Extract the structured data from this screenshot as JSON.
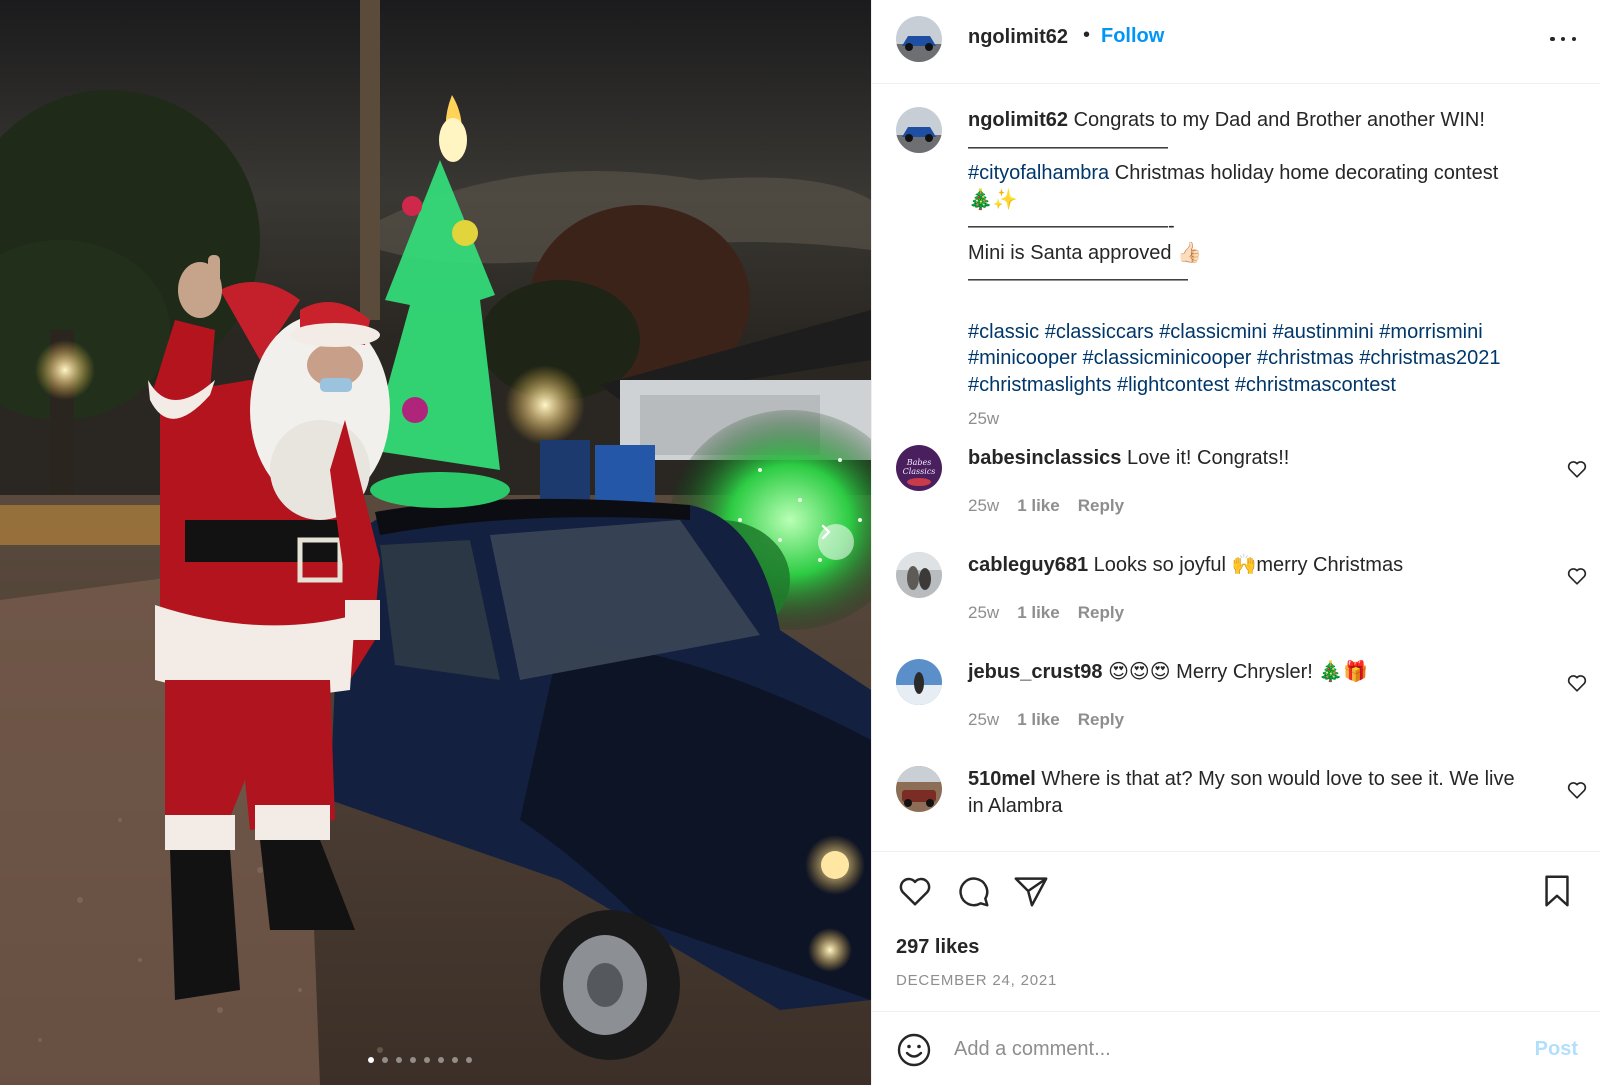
{
  "post": {
    "username": "ngolimit62",
    "separator": "•",
    "follow_label": "Follow",
    "more_options_icon": "ellipsis-icon"
  },
  "caption": {
    "username": "ngolimit62",
    "line1": "Congrats to my Dad and Brother another WIN!",
    "divider1": "——————————",
    "hashtag_city": "#cityofalhambra",
    "contest_text": "Christmas holiday home decorating contest",
    "contest_emoji": "🎄✨",
    "divider2": "——————————-",
    "santa_text": "Mini is Santa approved",
    "santa_emoji": "👍🏻",
    "divider3": "———————————",
    "hashtags": [
      "#classic",
      "#classiccars",
      "#classicmini",
      "#austinmini",
      "#morrismini",
      "#minicooper",
      "#classicminicooper",
      "#christmas",
      "#christmas2021",
      "#christmaslights",
      "#lightcontest",
      "#christmascontest"
    ],
    "time": "25w"
  },
  "comments": [
    {
      "username": "babesinclassics",
      "text": "Love it! Congrats!!",
      "time": "25w",
      "likes": "1 like",
      "reply": "Reply",
      "avatar_text": "Babes Classics"
    },
    {
      "username": "cableguy681",
      "text": "Looks so joyful 🙌merry Christmas",
      "time": "25w",
      "likes": "1 like",
      "reply": "Reply"
    },
    {
      "username": "jebus_crust98",
      "text": "😍😍😍 Merry Chrysler! 🎄🎁",
      "time": "25w",
      "likes": "1 like",
      "reply": "Reply"
    },
    {
      "username": "510mel",
      "text": "Where is that at? My son would love to see it. We live in Alambra"
    }
  ],
  "actions": {
    "likes": "297 likes",
    "date": "DECEMBER 24, 2021",
    "icons": [
      "heart-icon",
      "comment-icon",
      "share-icon",
      "bookmark-icon"
    ]
  },
  "comment_box": {
    "placeholder": "Add a comment...",
    "post_label": "Post"
  },
  "carousel": {
    "slides": 8,
    "active": 1
  },
  "colors": {
    "link": "#0095f6",
    "hashtag": "#00376b",
    "muted": "#8e8e8e",
    "post_disabled": "#b2dffc"
  }
}
